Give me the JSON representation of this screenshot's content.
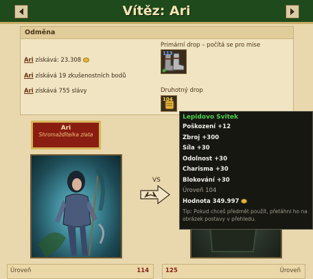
{
  "header": {
    "title": "Vítěz: Ari",
    "prev_icon": "arrow-left-icon",
    "next_icon": "arrow-right-icon"
  },
  "reward": {
    "heading": "Odměna",
    "lines": [
      {
        "name": "Ari",
        "text": " získává: 23.308"
      },
      {
        "name": "Ari",
        "text": " získává 19 zkušenostních bodů"
      },
      {
        "name": "Ari",
        "text": " získává 755 slávy"
      }
    ],
    "primary_drop_label": "Primární drop – počítá se pro mise",
    "primary_item_count": "113",
    "secondary_drop_label": "Druhotný drop",
    "secondary_item_count": "104"
  },
  "winner": {
    "name": "Ari",
    "title": "Shromažďitelka zlata",
    "level_label": "Úroveň",
    "level_value": "114"
  },
  "loser": {
    "level_value": "125",
    "level_label": "Úroveň"
  },
  "vs_label": "VS",
  "tooltip": {
    "title": "Lepidovo Svitek",
    "stats": [
      "Poškození +12",
      "Zbroj +300",
      "Síla +30",
      "Odolnost +30",
      "Charisma +30",
      "Blokování +30"
    ],
    "level": "Úroveň 104",
    "price": "Hodnota 349.997",
    "tip": "Tip: Pokud chceš předmět použít, přetáhni ho na obrázek postavy v přehledu."
  },
  "colors": {
    "header_bg": "#1f4a1b",
    "name_plate_bg": "#8a1d12",
    "tooltip_title": "#4ed24e"
  }
}
